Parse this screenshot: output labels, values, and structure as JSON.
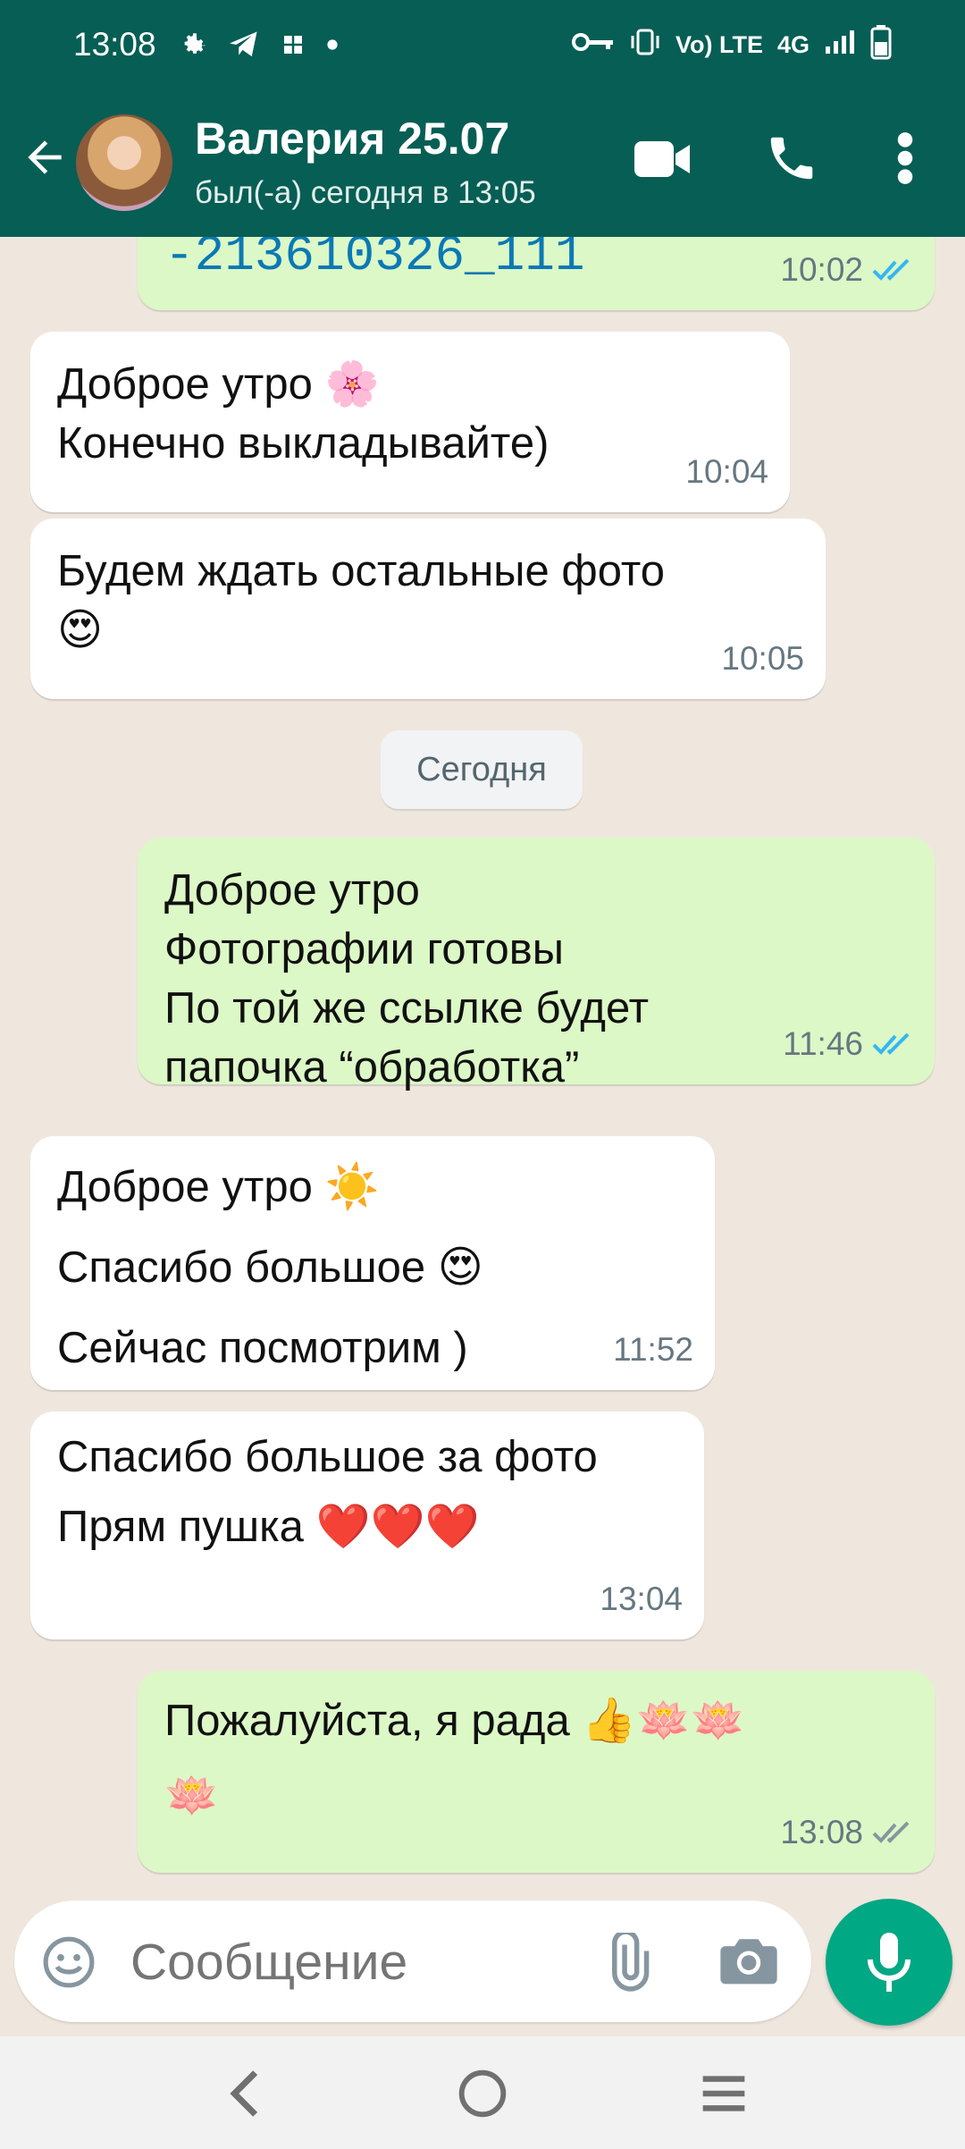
{
  "status_bar": {
    "time": "13:08",
    "volte": "Vo) LTE",
    "network": "4G"
  },
  "contact": {
    "name": "Валерия 25.07",
    "status": "был(-а) сегодня в 13:05"
  },
  "messages": [
    {
      "direction": "out",
      "text": "-213610326_111",
      "time": "10:02",
      "ticks": "read"
    },
    {
      "direction": "in",
      "text": "Доброе утро 🌸\nКонечно выкладывайте)",
      "time": "10:04"
    },
    {
      "direction": "in",
      "text": "Будем ждать остальные фото\n😍",
      "time": "10:05"
    },
    {
      "direction": "out",
      "text": "Доброе утро\nФотографии готовы\nПо той же ссылке будет\nпапочка “обработка”",
      "time": "11:46",
      "ticks": "read"
    },
    {
      "direction": "in",
      "text": "Доброе утро ☀️\nСпасибо большое 😍\nСейчас посмотрим )",
      "time": "11:52"
    },
    {
      "direction": "in",
      "text": "Спасибо большое за фото\nПрям пушка ❤️❤️❤️",
      "time": "13:04"
    },
    {
      "direction": "out",
      "text": "Пожалуйста, я рада 👍🪷🪷\n🪷",
      "time": "13:08",
      "ticks": "delivered"
    }
  ],
  "date_separator": "Сегодня",
  "composer": {
    "placeholder": "Сообщение"
  },
  "colors": {
    "header": "#075e54",
    "outgoing_bubble": "#dcf8c6",
    "incoming_bubble": "#ffffff",
    "chat_background": "#efe7de",
    "read_tick": "#34b7f1",
    "mic_button": "#00a884"
  },
  "icons": [
    "back-arrow-icon",
    "video-call-icon",
    "phone-icon",
    "more-vert-icon",
    "emoji-icon",
    "attach-icon",
    "camera-icon",
    "mic-icon"
  ]
}
